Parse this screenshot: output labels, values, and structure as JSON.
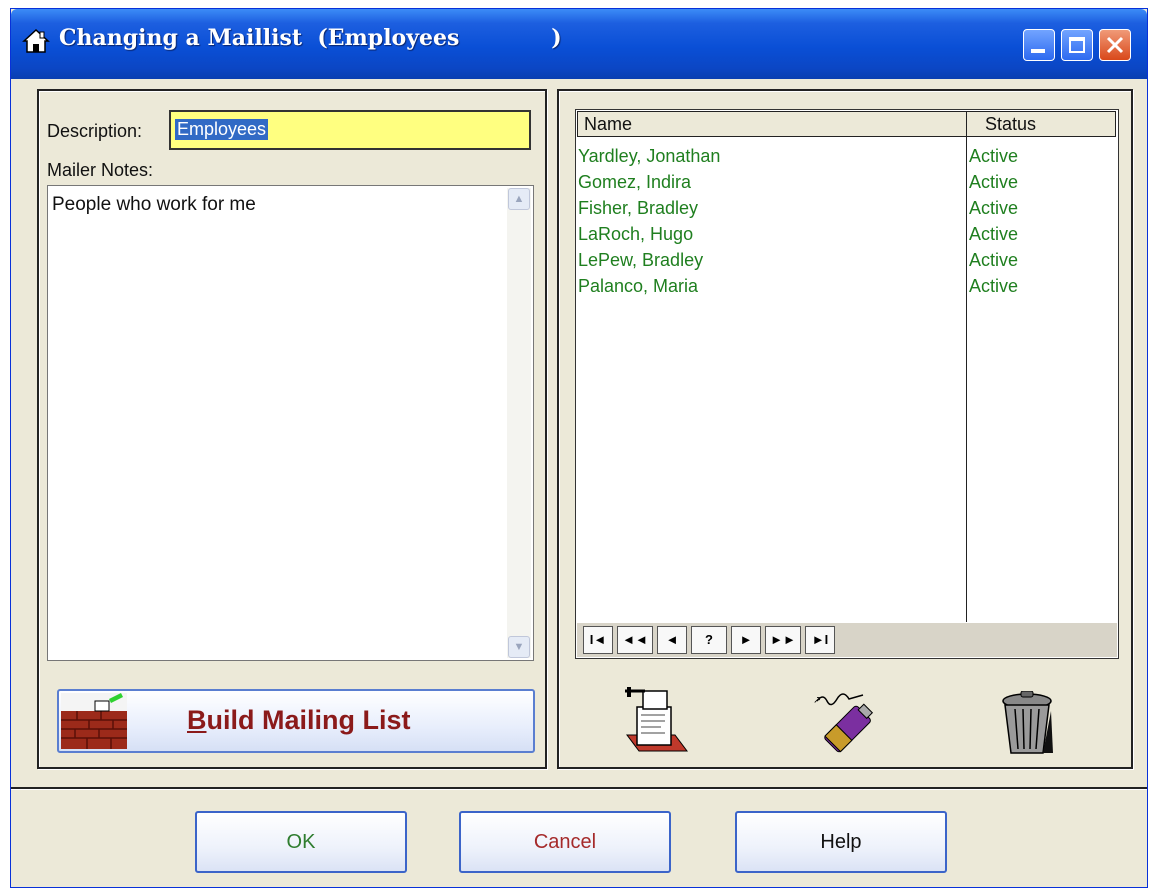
{
  "window": {
    "title": "Changing a Maillist  (Employees            )",
    "icon": "house-icon",
    "controls": [
      "minimize",
      "maximize",
      "close"
    ]
  },
  "left_panel": {
    "description_label": "Description:",
    "description_value": "Employees",
    "notes_label": "Mailer Notes:",
    "notes_value": "People who work for me",
    "build_button": {
      "label_first": "B",
      "label_rest": "uild Mailing List",
      "icon": "brick-wall-icon"
    }
  },
  "grid": {
    "columns": [
      "Name",
      "Status"
    ],
    "rows": [
      {
        "name": "Yardley, Jonathan",
        "status": "Active"
      },
      {
        "name": "Gomez, Indira",
        "status": "Active"
      },
      {
        "name": "Fisher, Bradley",
        "status": "Active"
      },
      {
        "name": "LaRoch, Hugo",
        "status": "Active"
      },
      {
        "name": "LePew, Bradley",
        "status": "Active"
      },
      {
        "name": "Palanco, Maria",
        "status": "Active"
      }
    ],
    "row_color": "#1f7f1f",
    "nav": [
      "I◄",
      "◄◄",
      "◄",
      "?",
      "►",
      "►►",
      "►I"
    ]
  },
  "tools": [
    "mail-list-printer-icon",
    "spray-pen-icon",
    "trash-can-icon"
  ],
  "buttons": {
    "ok": "OK",
    "cancel": "Cancel",
    "help": "Help"
  },
  "colors": {
    "ok_text": "#2f7d2f",
    "cancel_text": "#a52a2a",
    "help_text": "#111111"
  }
}
